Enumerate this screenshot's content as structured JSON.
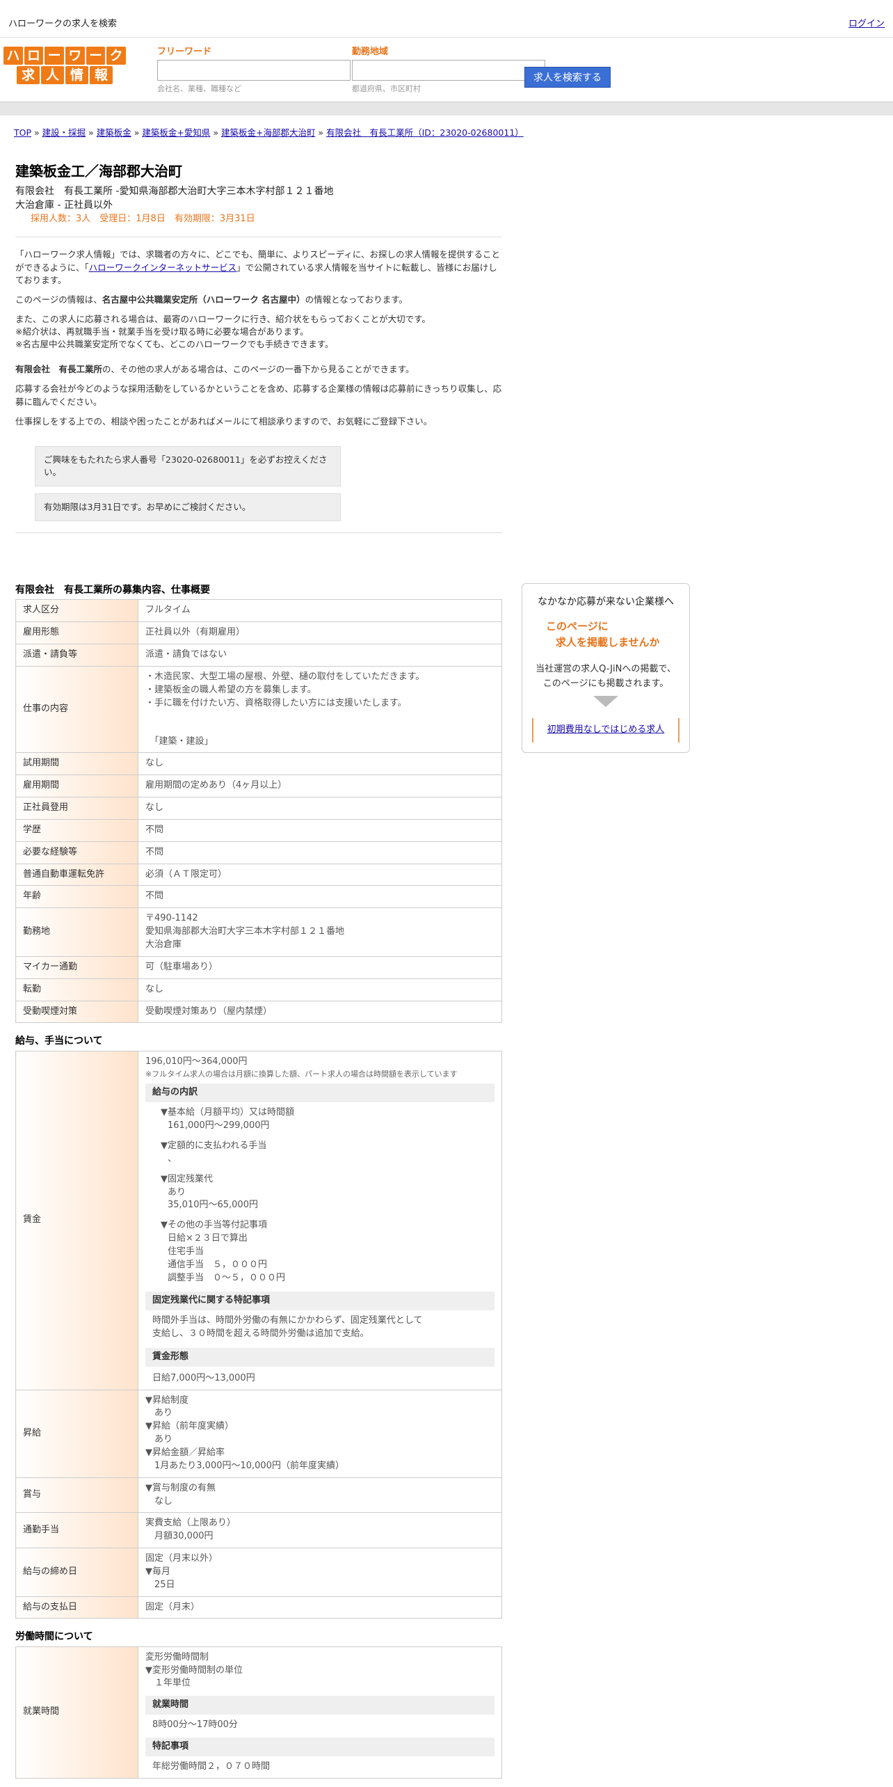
{
  "topbar": {
    "title": "ハローワークの求人を検索",
    "login": "ログイン"
  },
  "logo": {
    "line1": [
      "ハ",
      "ロ",
      "ー",
      "ワ",
      "ー",
      "ク"
    ],
    "line2": [
      "求",
      "人",
      "情",
      "報"
    ]
  },
  "search": {
    "freeword_label": "フリーワード",
    "freeword_placeholder": "会社名、業種、職種など",
    "area_label": "勤務地域",
    "area_placeholder": "都道府県、市区町村",
    "button": "求人を検索する"
  },
  "breadcrumb": [
    "TOP",
    "建設・採掘",
    "建築板金",
    "建築板金+愛知県",
    "建築板金+海部郡大治町",
    "有限会社　有長工業所（ID：23020-02680011）"
  ],
  "job": {
    "title": "建築板金工／海部郡大治町",
    "company_line": "有限会社　有長工業所 -愛知県海部郡大治町大字三本木字村部１２１番地",
    "site_line": "大治倉庫 - 正社員以外",
    "meta": "採用人数：3人　受理日：1月8日　有効期限：3月31日"
  },
  "intro": {
    "p1a": "「ハローワーク求人情報」では、求職者の方々に、どこでも、簡単に、よりスピーディに、お探しの求人情報を提供することができるように、「",
    "p1link": "ハローワークインターネットサービス",
    "p1b": "」で公開されている求人情報を当サイトに転載し、皆様にお届けしております。",
    "p2a": "このページの情報は、",
    "p2b": "名古屋中公共職業安定所（ハローワーク 名古屋中）",
    "p2c": "の情報となっております。",
    "p3": [
      "また、この求人に応募される場合は、最寄のハローワークに行き、紹介状をもらっておくことが大切です。",
      "※紹介状は、再就職手当・就業手当を受け取る時に必要な場合があります。",
      "※名古屋中公共職業安定所でなくても、どこのハローワークでも手続きできます。"
    ],
    "p4a": "有限会社　有長工業所",
    "p4b": "の、その他の求人がある場合は、このページの一番下から見ることができます。",
    "p5": "応募する会社が今どのような採用活動をしているかということを含め、応募する企業様の情報は応募前にきっちり収集し、応募に臨んでください。",
    "p6": "仕事探しをする上での、相談や困ったことがあればメールにて相談承りますので、お気軽にご登録下さい。",
    "note1": "ご興味をもたれたら求人番号「23020-02680011」を必ずお控えください。",
    "note2": "有効期限は3月31日です。お早めにご検討ください。"
  },
  "sections": {
    "overview": "有限会社　有長工業所の募集内容、仕事概要",
    "wage": "給与、手当について",
    "hours": "労働時間について"
  },
  "overview_rows": [
    {
      "label": "求人区分",
      "value": [
        "フルタイム"
      ]
    },
    {
      "label": "雇用形態",
      "value": [
        "正社員以外（有期雇用）"
      ]
    },
    {
      "label": "派遣・請負等",
      "value": [
        "派遣・請負ではない"
      ]
    },
    {
      "label": "仕事の内容",
      "value": [
        "・木造民家、大型工場の屋根、外壁、樋の取付をしていただきます。",
        "・建築板金の職人希望の方を募集します。",
        "・手に職を付けたい方、資格取得したい方には支援いたします。",
        "",
        "",
        "　「建築・建設」"
      ]
    },
    {
      "label": "試用期間",
      "value": [
        "なし"
      ]
    },
    {
      "label": "雇用期間",
      "value": [
        "雇用期間の定めあり（4ヶ月以上）"
      ]
    },
    {
      "label": "正社員登用",
      "value": [
        "なし"
      ]
    },
    {
      "label": "学歴",
      "value": [
        "不問"
      ]
    },
    {
      "label": "必要な経験等",
      "value": [
        "不問"
      ]
    },
    {
      "label": "普通自動車運転免許",
      "value": [
        "必須（ＡＴ限定可）"
      ]
    },
    {
      "label": "年齢",
      "value": [
        "不問"
      ]
    },
    {
      "label": "勤務地",
      "value": [
        "〒490-1142",
        "愛知県海部郡大治町大字三本木字村部１２１番地",
        "大治倉庫"
      ]
    },
    {
      "label": "マイカー通勤",
      "value": [
        "可（駐車場あり）"
      ]
    },
    {
      "label": "転勤",
      "value": [
        "なし"
      ]
    },
    {
      "label": "受動喫煙対策",
      "value": [
        "受動喫煙対策あり（屋内禁煙）"
      ]
    }
  ],
  "wage": {
    "label": "賃金",
    "range": "196,010円〜364,000円",
    "note": "※フルタイム求人の場合は月額に換算した額、パート求人の場合は時間額を表示しています",
    "breakdown_title": "給与の内訳",
    "base_title": "▼基本給（月額平均）又は時間額",
    "base_value": "161,000円〜299,000円",
    "fixed_allow_title": "▼定額的に支払われる手当",
    "fixed_allow_value": "、",
    "overtime_title": "▼固定残業代",
    "overtime_lines": [
      "あり",
      "35,010円〜65,000円"
    ],
    "other_title": "▼その他の手当等付記事項",
    "other_lines": [
      "日給×２３日で算出",
      "住宅手当",
      "通信手当　５，０００円",
      "調整手当　０〜５，０００円"
    ],
    "ot_note_title": "固定残業代に関する特記事項",
    "ot_note_lines": [
      "時間外手当は、時間外労働の有無にかかわらず、固定残業代として",
      "支給し、３０時間を超える時間外労働は追加で支給。"
    ],
    "form_title": "賃金形態",
    "form_value": "日給7,000円〜13,000円"
  },
  "wage_rows": [
    {
      "label": "昇給",
      "value": [
        "▼昇給制度",
        "　あり",
        "▼昇給（前年度実績）",
        "　あり",
        "▼昇給金額／昇給率",
        "　1月あたり3,000円〜10,000円（前年度実績）"
      ]
    },
    {
      "label": "賞与",
      "value": [
        "▼賞与制度の有無",
        "　なし"
      ]
    },
    {
      "label": "通勤手当",
      "value": [
        "実費支給（上限あり）",
        "　月額30,000円"
      ]
    },
    {
      "label": "給与の締め日",
      "value": [
        "固定（月末以外）",
        "▼毎月",
        "　25日"
      ]
    },
    {
      "label": "給与の支払日",
      "value": [
        "固定（月末）"
      ]
    }
  ],
  "hours": {
    "label": "就業時間",
    "lines": [
      "変形労働時間制",
      "▼変形労働時間制の単位",
      "　１年単位"
    ],
    "sub1": "就業時間",
    "sub1_value": "8時00分〜17時00分",
    "sub2": "特記事項",
    "sub2_value": "年総労働時間２，０７０時間"
  },
  "side": {
    "heading": "なかなか応募が来ない企業様へ",
    "catch1": "このページに",
    "catch2": "求人を掲載しませんか",
    "desc1": "当社運営の求人Q-JiNへの掲載で、",
    "desc2": "このページにも掲載されます。",
    "cta": "初期費用なしではじめる求人"
  }
}
